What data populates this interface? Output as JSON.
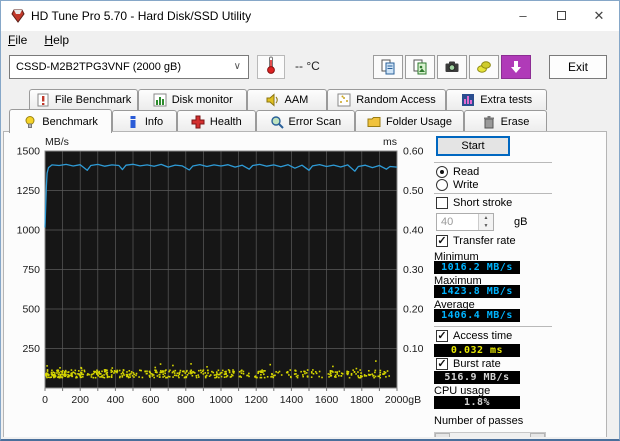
{
  "window": {
    "title": "HD Tune Pro 5.70 - Hard Disk/SSD Utility"
  },
  "menu": {
    "file": "File",
    "help": "Help"
  },
  "toolbar": {
    "drive_select": "CSSD-M2B2TPG3VNF (2000 gB)",
    "temperature": "-- °C",
    "exit_label": "Exit"
  },
  "tabs": {
    "row1": [
      {
        "label": "File Benchmark"
      },
      {
        "label": "Disk monitor"
      },
      {
        "label": "AAM"
      },
      {
        "label": "Random Access"
      },
      {
        "label": "Extra tests"
      }
    ],
    "row2": [
      {
        "label": "Benchmark",
        "active": true
      },
      {
        "label": "Info"
      },
      {
        "label": "Health"
      },
      {
        "label": "Error Scan"
      },
      {
        "label": "Folder Usage"
      },
      {
        "label": "Erase"
      }
    ]
  },
  "panel": {
    "start_label": "Start",
    "read_label": "Read",
    "write_label": "Write",
    "short_stroke_label": "Short stroke",
    "short_stroke_value": "40",
    "short_stroke_unit": "gB",
    "transfer_rate_label": "Transfer rate",
    "minimum_label": "Minimum",
    "minimum_value": "1016.2 MB/s",
    "maximum_label": "Maximum",
    "maximum_value": "1423.8 MB/s",
    "average_label": "Average",
    "average_value": "1406.4 MB/s",
    "access_time_label": "Access time",
    "access_time_value": "0.032 ms",
    "burst_rate_label": "Burst rate",
    "burst_rate_value": "516.9 MB/s",
    "cpu_usage_label": "CPU usage",
    "cpu_usage_value": "1.8%",
    "passes_label": "Number of passes"
  },
  "colors": {
    "val_cyan": "#00b4ff",
    "val_yellow": "#e8e800",
    "val_light": "#d6d6d6",
    "line": "#2e9bd6",
    "dots": "#d6d600",
    "plot_bg": "#161616",
    "grid": "#5b5b5b",
    "axis_text": "#1a1a1a"
  },
  "chart_data": {
    "type": "line",
    "title": "Benchmark transfer rate and access time vs disk position",
    "x_unit": "gB",
    "x_max": 2000,
    "x_ticks": [
      0,
      200,
      400,
      600,
      800,
      1000,
      1200,
      1400,
      1600,
      1800,
      2000
    ],
    "left_axis": {
      "label": "MB/s",
      "max": 1500,
      "ticks": [
        1500,
        1250,
        1000,
        750,
        500,
        250
      ]
    },
    "right_axis": {
      "label": "ms",
      "max": 0.6,
      "ticks": [
        "0.60",
        "0.50",
        "0.40",
        "0.30",
        "0.20",
        "0.10"
      ]
    },
    "grid": true,
    "series": [
      {
        "name": "transfer_rate_MBs",
        "points": [
          [
            0,
            1016
          ],
          [
            4,
            1150
          ],
          [
            8,
            1280
          ],
          [
            12,
            1360
          ],
          [
            20,
            1395
          ],
          [
            40,
            1412
          ],
          [
            80,
            1408
          ],
          [
            120,
            1415
          ],
          [
            160,
            1405
          ],
          [
            200,
            1413
          ],
          [
            240,
            1378
          ],
          [
            260,
            1408
          ],
          [
            300,
            1415
          ],
          [
            340,
            1404
          ],
          [
            380,
            1412
          ],
          [
            420,
            1408
          ],
          [
            440,
            1382
          ],
          [
            460,
            1410
          ],
          [
            500,
            1416
          ],
          [
            540,
            1406
          ],
          [
            580,
            1412
          ],
          [
            620,
            1403
          ],
          [
            660,
            1415
          ],
          [
            700,
            1398
          ],
          [
            740,
            1411
          ],
          [
            780,
            1406
          ],
          [
            820,
            1380
          ],
          [
            840,
            1405
          ],
          [
            880,
            1414
          ],
          [
            920,
            1402
          ],
          [
            960,
            1412
          ],
          [
            1000,
            1405
          ],
          [
            1040,
            1413
          ],
          [
            1080,
            1398
          ],
          [
            1120,
            1410
          ],
          [
            1160,
            1385
          ],
          [
            1180,
            1408
          ],
          [
            1220,
            1415
          ],
          [
            1260,
            1404
          ],
          [
            1300,
            1412
          ],
          [
            1340,
            1400
          ],
          [
            1380,
            1413
          ],
          [
            1420,
            1391
          ],
          [
            1460,
            1410
          ],
          [
            1500,
            1378
          ],
          [
            1520,
            1406
          ],
          [
            1560,
            1414
          ],
          [
            1600,
            1402
          ],
          [
            1640,
            1411
          ],
          [
            1680,
            1399
          ],
          [
            1720,
            1412
          ],
          [
            1760,
            1372
          ],
          [
            1780,
            1402
          ],
          [
            1820,
            1410
          ],
          [
            1860,
            1395
          ],
          [
            1900,
            1408
          ],
          [
            1940,
            1385
          ],
          [
            1960,
            1402
          ],
          [
            2000,
            1398
          ]
        ]
      },
      {
        "name": "access_time_ms_scatter",
        "scatter": {
          "count": 520,
          "seed": 7,
          "x_range": [
            5,
            1960
          ],
          "ms_base": 0.032,
          "ms_spread": 0.02,
          "left_density_power": 1.35
        }
      }
    ]
  }
}
